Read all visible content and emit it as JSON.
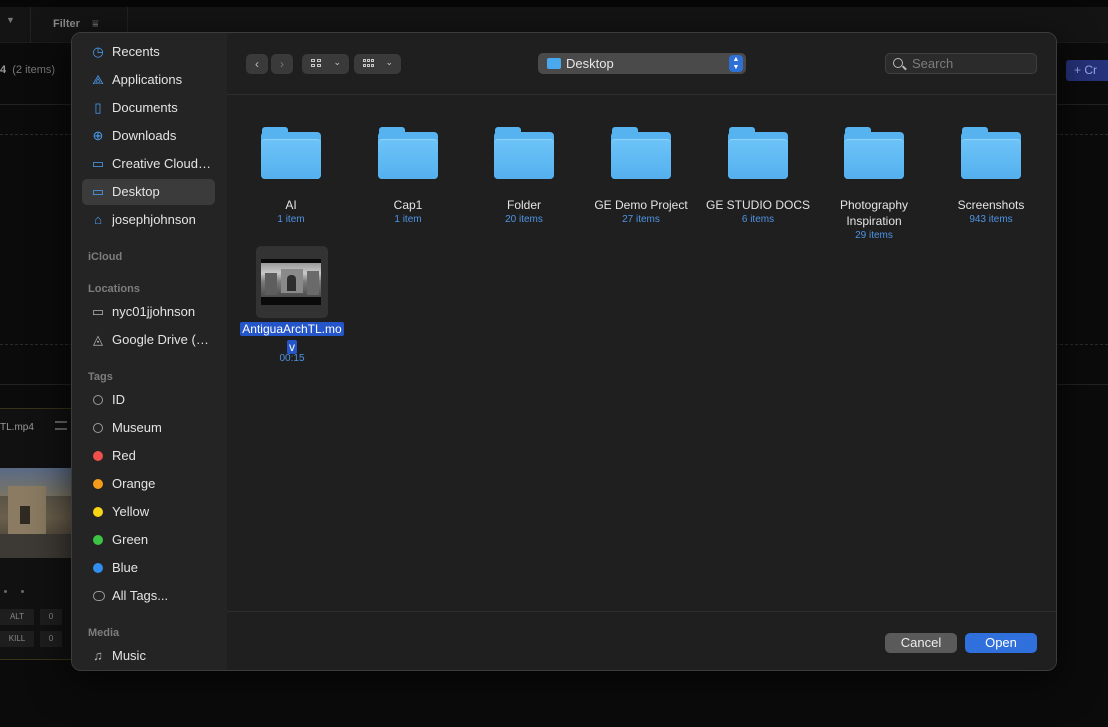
{
  "background": {
    "filter_label": "Filter",
    "count_number": "4",
    "count_text": "(2 items)",
    "create_label": "+ Cr",
    "card_title": "TL.mp4",
    "stats": [
      {
        "label": "ALT",
        "value": "0"
      },
      {
        "label": "KILL",
        "value": "0"
      }
    ]
  },
  "sidebar": {
    "favorites": [
      {
        "label": "Recents",
        "icon": "clock-icon",
        "glyph": "◷"
      },
      {
        "label": "Applications",
        "icon": "applications-icon",
        "glyph": "⟁"
      },
      {
        "label": "Documents",
        "icon": "document-icon",
        "glyph": "▯"
      },
      {
        "label": "Downloads",
        "icon": "download-icon",
        "glyph": "⊕"
      },
      {
        "label": "Creative Cloud Files",
        "icon": "folder-icon",
        "glyph": "▭"
      },
      {
        "label": "Desktop",
        "icon": "desktop-icon",
        "glyph": "▭"
      },
      {
        "label": "josephjohnson",
        "icon": "home-icon",
        "glyph": "⌂"
      }
    ],
    "icloud_header": "iCloud",
    "locations_header": "Locations",
    "locations": [
      {
        "label": "nyc01jjohnson",
        "icon": "laptop-icon",
        "glyph": "▭"
      },
      {
        "label": "Google Drive (Google Drive)",
        "icon": "drive-icon",
        "glyph": "◬"
      }
    ],
    "tags_header": "Tags",
    "tags": [
      {
        "label": "ID",
        "color": ""
      },
      {
        "label": "Museum",
        "color": ""
      },
      {
        "label": "Red",
        "color": "#f0504b"
      },
      {
        "label": "Orange",
        "color": "#f59c1a"
      },
      {
        "label": "Yellow",
        "color": "#f5d515"
      },
      {
        "label": "Green",
        "color": "#3dc444"
      },
      {
        "label": "Blue",
        "color": "#2f8ef0"
      },
      {
        "label": "All Tags...",
        "color": "all"
      }
    ],
    "media_header": "Media",
    "media": [
      {
        "label": "Music",
        "icon": "music-note-icon",
        "glyph": "♫"
      }
    ]
  },
  "toolbar": {
    "back_glyph": "‹",
    "forward_glyph": "›",
    "path_label": "Desktop",
    "search_placeholder": "Search"
  },
  "files": [
    {
      "name": "AI",
      "count": "1 item"
    },
    {
      "name": "Cap1",
      "count": "1 item"
    },
    {
      "name": "Folder",
      "count": "20 items"
    },
    {
      "name": "GE Demo Project",
      "count": "27 items"
    },
    {
      "name": "GE STUDIO DOCS",
      "count": "6 items"
    },
    {
      "name": "Photography Inspiration",
      "count": "29 items"
    },
    {
      "name": "Screenshots",
      "count": "943 items"
    }
  ],
  "movie": {
    "name": "AntiguaArchTL.mov",
    "duration": "00:15"
  },
  "buttons": {
    "cancel": "Cancel",
    "open": "Open"
  },
  "colors": {
    "accent": "#2f70dd",
    "folder": "#56b3f0",
    "selection": "#2456c9"
  }
}
